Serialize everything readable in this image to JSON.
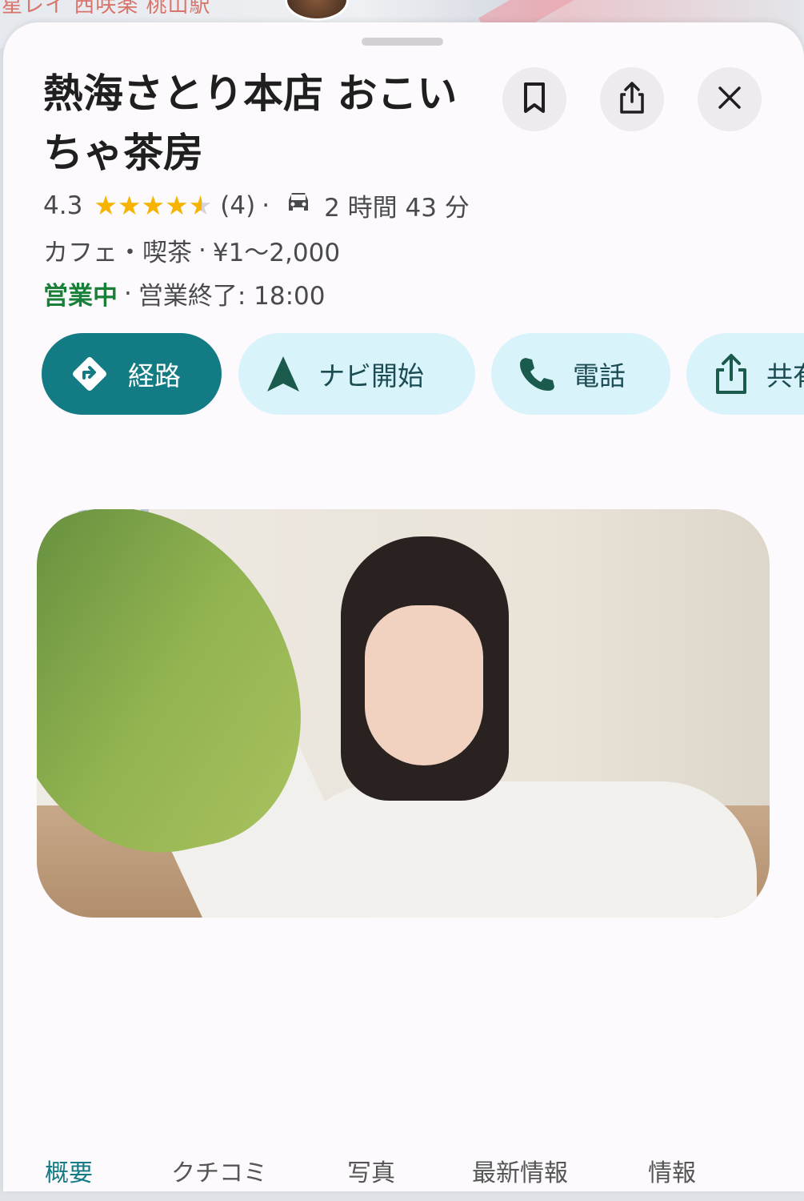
{
  "map": {
    "label": "星レイ 西咲楽 桃山駅"
  },
  "place": {
    "name": "熱海さとり本店 おこいちゃ茶房",
    "rating": "4.3",
    "stars": 4.3,
    "review_count": "(4)",
    "separator": "·",
    "travel_time": "2 時間 43 分",
    "category": "カフェ・喫茶",
    "price": "¥1～2,000",
    "open_status": "営業中",
    "hours": "営業終了: 18:00"
  },
  "actions": {
    "route_label": "経路",
    "nav_label": "ナビ開始",
    "call_label": "電話",
    "share_label": "共有"
  },
  "tabs": [
    {
      "label": "概要"
    },
    {
      "label": "クチコミ"
    },
    {
      "label": "写真"
    },
    {
      "label": "最新情報"
    },
    {
      "label": "情報"
    }
  ],
  "colors": {
    "accent": "#137b84",
    "chip_bg": "#d8f3fa",
    "open": "#188038",
    "star": "#f6b400"
  },
  "icons": {
    "save": "bookmark-icon",
    "share": "share-icon",
    "close": "close-icon",
    "route": "directions-icon",
    "nav": "navigation-arrow-icon",
    "call": "phone-icon",
    "car": "car-icon"
  }
}
